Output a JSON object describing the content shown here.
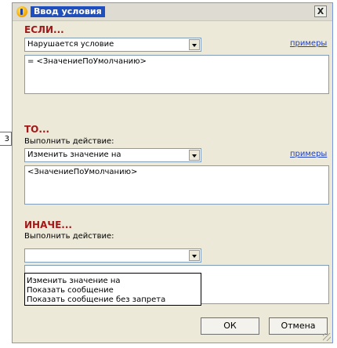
{
  "background_fragment": {
    "text": "3"
  },
  "window": {
    "title": "Ввод условия",
    "close_label": "X"
  },
  "if_section": {
    "title": "ЕСЛИ...",
    "condition_value": "Нарушается условие",
    "examples_link": "примеры",
    "expression": "= <ЗначениеПоУмолчанию>"
  },
  "then_section": {
    "title": "ТО...",
    "action_caption": "Выполнить действие:",
    "action_value": "Изменить значение на",
    "examples_link": "примеры",
    "expression": "<ЗначениеПоУмолчанию>"
  },
  "else_section": {
    "title": "ИНАЧЕ...",
    "action_caption": "Выполнить действие:",
    "action_value": "",
    "dropdown_options": [
      "Изменить значение на",
      "Показать сообщение",
      "Показать сообщение без запрета"
    ]
  },
  "buttons": {
    "ok": "ОК",
    "cancel": "Отмена"
  },
  "colors": {
    "section_title": "#a01818",
    "link": "#2040c0",
    "dialog_background": "#ece9d8"
  }
}
